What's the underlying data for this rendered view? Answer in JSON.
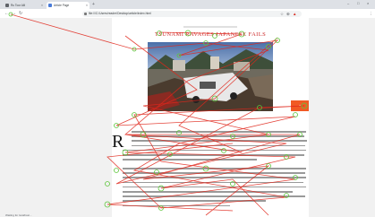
{
  "browser": {
    "tabs": [
      {
        "label": "Ru Tour Alli",
        "active": false
      },
      {
        "label": "Article Page",
        "active": true
      }
    ],
    "new_tab_symbol": "+",
    "window_controls": [
      "–",
      "□",
      "×"
    ],
    "address": "file:///C:/Users/reader/Desktop/article/index.html",
    "nav": {
      "back": "←",
      "forward": "→",
      "reload": "↻"
    },
    "toolbar_icons": [
      "☆",
      "⊕",
      "▲",
      "⋮"
    ]
  },
  "article": {
    "headline": "TSUNAMI RAVAGES JAPANESE FAILS",
    "button_label": "+",
    "dropcap": "R"
  },
  "status_bar": "Waiting for localhost..."
}
